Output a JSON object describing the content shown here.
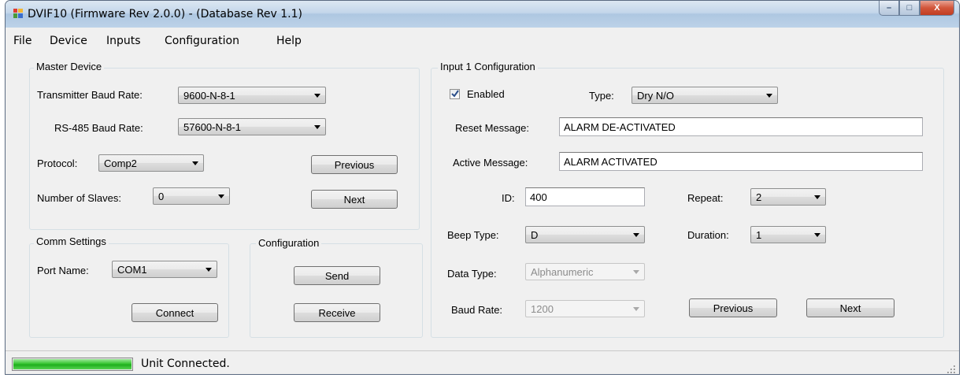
{
  "window": {
    "title": "DVIF10 (Firmware Rev 2.0.0) - (Database Rev 1.1)",
    "controls": {
      "minimize": "–",
      "maximize": "□",
      "close": "X"
    }
  },
  "menu": [
    "File",
    "Device",
    "Inputs",
    "Configuration",
    "Help"
  ],
  "master_device": {
    "title": "Master Device",
    "transmitter_baud_label": "Transmitter Baud Rate:",
    "transmitter_baud_value": "9600-N-8-1",
    "rs485_baud_label": "RS-485 Baud Rate:",
    "rs485_baud_value": "57600-N-8-1",
    "protocol_label": "Protocol:",
    "protocol_value": "Comp2",
    "slaves_label": "Number of Slaves:",
    "slaves_value": "0",
    "previous_label": "Previous",
    "next_label": "Next"
  },
  "comm_settings": {
    "title": "Comm Settings",
    "port_label": "Port Name:",
    "port_value": "COM1",
    "connect_label": "Connect"
  },
  "configuration": {
    "title": "Configuration",
    "send_label": "Send",
    "receive_label": "Receive"
  },
  "input_config": {
    "title": "Input 1 Configuration",
    "enabled_label": "Enabled",
    "enabled_checked": true,
    "type_label": "Type:",
    "type_value": "Dry N/O",
    "reset_message_label": "Reset Message:",
    "reset_message_value": "ALARM DE-ACTIVATED",
    "active_message_label": "Active Message:",
    "active_message_value": "ALARM ACTIVATED",
    "id_label": "ID:",
    "id_value": "400",
    "repeat_label": "Repeat:",
    "repeat_value": "2",
    "beep_type_label": "Beep Type:",
    "beep_type_value": "D",
    "duration_label": "Duration:",
    "duration_value": "1",
    "data_type_label": "Data Type:",
    "data_type_value": "Alphanumeric",
    "baud_rate_label": "Baud Rate:",
    "baud_rate_value": "1200",
    "previous_label": "Previous",
    "next_label": "Next"
  },
  "status": {
    "text": "Unit Connected.",
    "progress": 1.0
  },
  "colors": {
    "window_bg": "#f0f0f0",
    "progress_green": "#37c532",
    "title_gradient": "#c3d6ea"
  }
}
